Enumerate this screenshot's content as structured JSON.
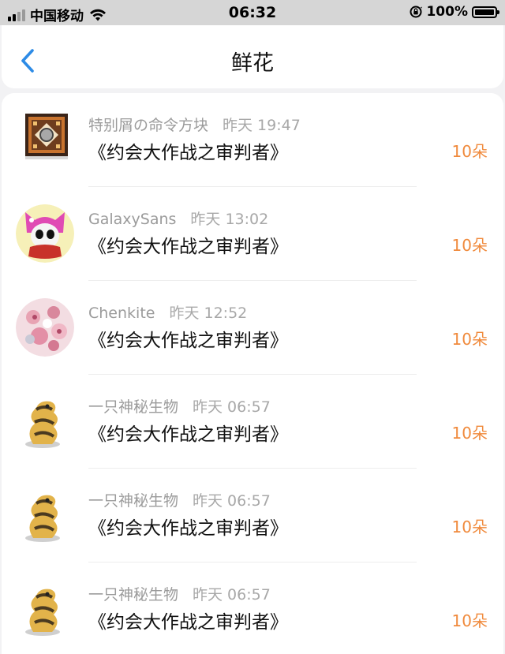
{
  "status_bar": {
    "carrier": "中国移动",
    "time": "06:32",
    "battery": "100%",
    "icons": [
      "signal-icon",
      "wifi-icon",
      "orientation-lock-icon",
      "battery-icon"
    ]
  },
  "nav": {
    "title": "鲜花",
    "back_icon": "chevron-left-icon"
  },
  "colors": {
    "accent": "#2d8be6",
    "count": "#f08a3c",
    "meta": "#9b9b9b"
  },
  "items": [
    {
      "name": "特别屑の命令方块",
      "time": "昨天 19:47",
      "book": "《约会大作战之审判者》",
      "count": "10朵",
      "avatar": "command-block-avatar"
    },
    {
      "name": "GalaxySans",
      "time": "昨天 13:02",
      "book": "《约会大作战之审判者》",
      "count": "10朵",
      "avatar": "pink-hood-skull-avatar"
    },
    {
      "name": "Chenkite",
      "time": "昨天 12:52",
      "book": "《约会大作战之审判者》",
      "count": "10朵",
      "avatar": "pink-floral-avatar"
    },
    {
      "name": "一只神秘生物",
      "time": "昨天 06:57",
      "book": "《约会大作战之审判者》",
      "count": "10朵",
      "avatar": "mystery-creature-avatar"
    },
    {
      "name": "一只神秘生物",
      "time": "昨天 06:57",
      "book": "《约会大作战之审判者》",
      "count": "10朵",
      "avatar": "mystery-creature-avatar"
    },
    {
      "name": "一只神秘生物",
      "time": "昨天 06:57",
      "book": "《约会大作战之审判者》",
      "count": "10朵",
      "avatar": "mystery-creature-avatar"
    }
  ]
}
